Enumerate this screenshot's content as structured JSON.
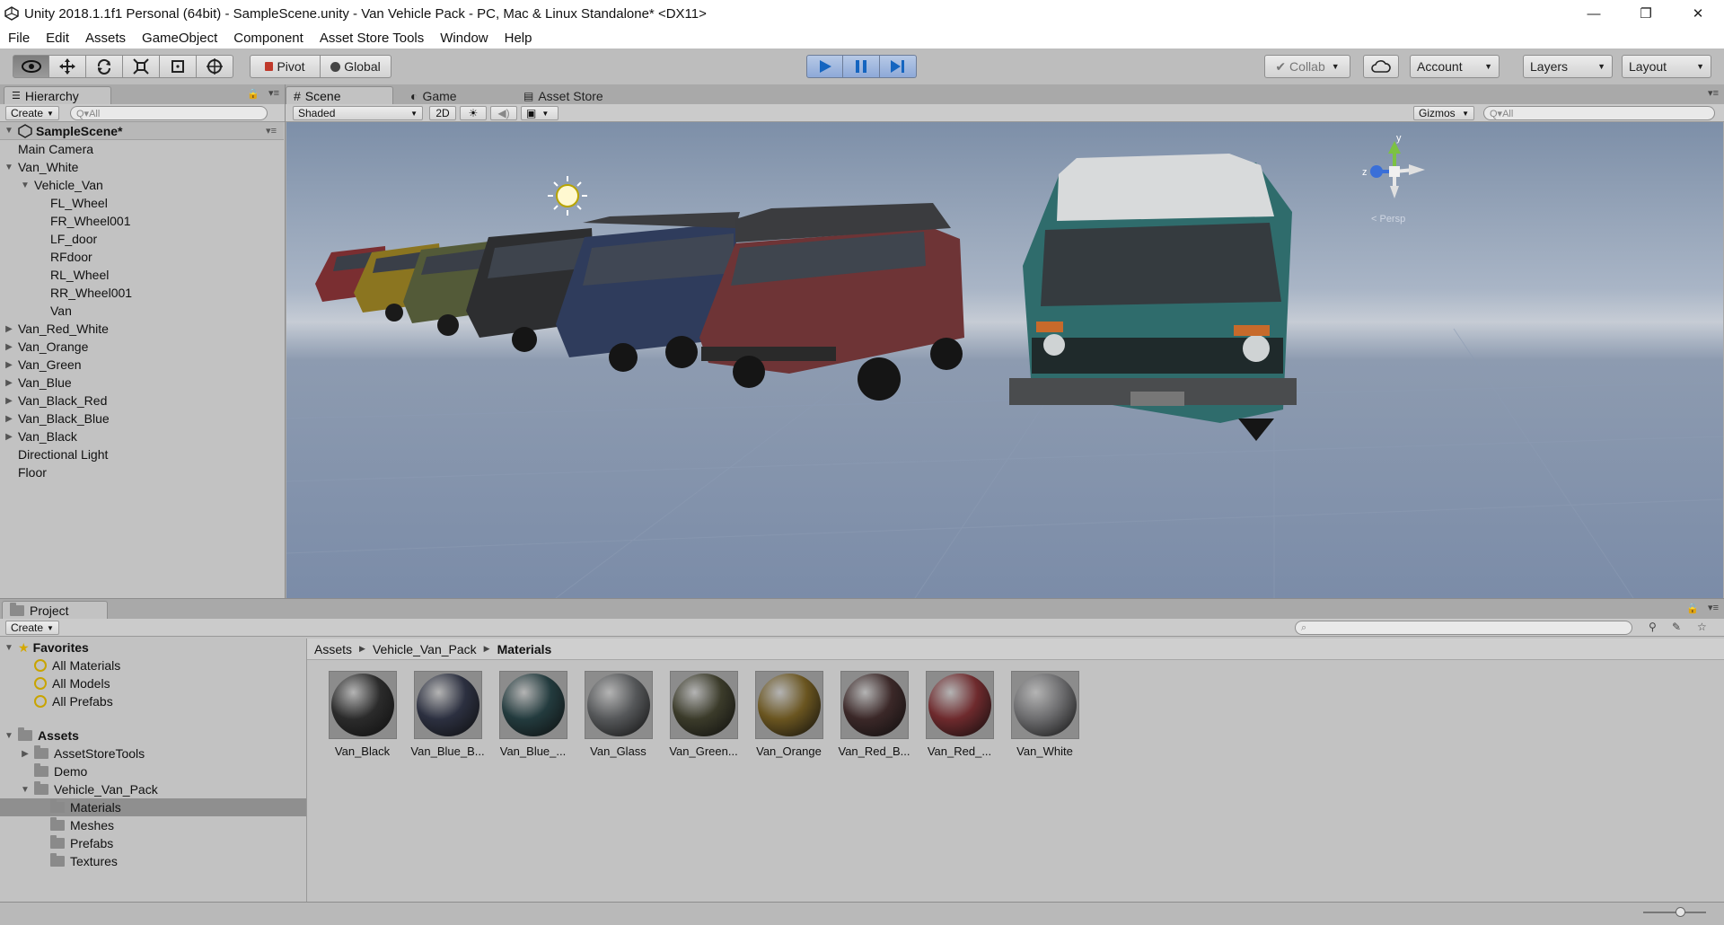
{
  "window": {
    "title": "Unity 2018.1.1f1 Personal (64bit) - SampleScene.unity - Van Vehicle Pack - PC, Mac & Linux Standalone* <DX11>",
    "minimize": "—",
    "maximize": "❐",
    "close": "✕"
  },
  "menu": [
    "File",
    "Edit",
    "Assets",
    "GameObject",
    "Component",
    "Asset Store Tools",
    "Window",
    "Help"
  ],
  "toolbar": {
    "pivot": "Pivot",
    "global": "Global",
    "collab": "Collab",
    "account": "Account",
    "layers": "Layers",
    "layout": "Layout",
    "playmode_active": true
  },
  "hierarchy": {
    "tab": "Hierarchy",
    "create": "Create",
    "search_placeholder": "Q▾All",
    "scene": "SampleScene*",
    "items": [
      {
        "label": "Main Camera",
        "depth": 1,
        "arrow": ""
      },
      {
        "label": "Van_White",
        "depth": 1,
        "arrow": "▼"
      },
      {
        "label": "Vehicle_Van",
        "depth": 2,
        "arrow": "▼"
      },
      {
        "label": "FL_Wheel",
        "depth": 3,
        "arrow": ""
      },
      {
        "label": "FR_Wheel001",
        "depth": 3,
        "arrow": ""
      },
      {
        "label": "LF_door",
        "depth": 3,
        "arrow": ""
      },
      {
        "label": "RFdoor",
        "depth": 3,
        "arrow": ""
      },
      {
        "label": "RL_Wheel",
        "depth": 3,
        "arrow": ""
      },
      {
        "label": "RR_Wheel001",
        "depth": 3,
        "arrow": ""
      },
      {
        "label": "Van",
        "depth": 3,
        "arrow": ""
      },
      {
        "label": "Van_Red_White",
        "depth": 1,
        "arrow": "▶"
      },
      {
        "label": "Van_Orange",
        "depth": 1,
        "arrow": "▶"
      },
      {
        "label": "Van_Green",
        "depth": 1,
        "arrow": "▶"
      },
      {
        "label": "Van_Blue",
        "depth": 1,
        "arrow": "▶"
      },
      {
        "label": "Van_Black_Red",
        "depth": 1,
        "arrow": "▶"
      },
      {
        "label": "Van_Black_Blue",
        "depth": 1,
        "arrow": "▶"
      },
      {
        "label": "Van_Black",
        "depth": 1,
        "arrow": "▶"
      },
      {
        "label": "Directional Light",
        "depth": 1,
        "arrow": ""
      },
      {
        "label": "Floor",
        "depth": 1,
        "arrow": ""
      }
    ]
  },
  "scene": {
    "tabs": [
      {
        "label": "Scene",
        "icon": "#",
        "active": true
      },
      {
        "label": "Game",
        "icon": "◐",
        "active": false
      },
      {
        "label": "Asset Store",
        "icon": "▤",
        "active": false
      }
    ],
    "shading": "Shaded",
    "mode_2d": "2D",
    "gizmos": "Gizmos",
    "search_placeholder": "Q▾All",
    "persp_label": "< Persp",
    "axis_y": "y",
    "axis_z": "z"
  },
  "project": {
    "tab": "Project",
    "create": "Create",
    "favorites_label": "Favorites",
    "favorites": [
      "All Materials",
      "All Models",
      "All Prefabs"
    ],
    "assets_label": "Assets",
    "folders": [
      {
        "label": "AssetStoreTools",
        "depth": 1,
        "arrow": "▶",
        "selected": false
      },
      {
        "label": "Demo",
        "depth": 1,
        "arrow": "",
        "selected": false
      },
      {
        "label": "Vehicle_Van_Pack",
        "depth": 1,
        "arrow": "▼",
        "selected": false
      },
      {
        "label": "Materials",
        "depth": 2,
        "arrow": "",
        "selected": true
      },
      {
        "label": "Meshes",
        "depth": 2,
        "arrow": "",
        "selected": false
      },
      {
        "label": "Prefabs",
        "depth": 2,
        "arrow": "",
        "selected": false
      },
      {
        "label": "Textures",
        "depth": 2,
        "arrow": "",
        "selected": false
      }
    ],
    "breadcrumb": [
      "Assets",
      "Vehicle_Van_Pack",
      "Materials"
    ],
    "materials": [
      {
        "label": "Van_Black",
        "color": "#2b2b2b"
      },
      {
        "label": "Van_Blue_B...",
        "color": "#2c3040"
      },
      {
        "label": "Van_Blue_...",
        "color": "#233b3e"
      },
      {
        "label": "Van_Glass",
        "color": "#555759"
      },
      {
        "label": "Van_Green...",
        "color": "#3b3b2a"
      },
      {
        "label": "Van_Orange",
        "color": "#6a5520"
      },
      {
        "label": "Van_Red_B...",
        "color": "#3b2828"
      },
      {
        "label": "Van_Red_...",
        "color": "#6e2a2d"
      },
      {
        "label": "Van_White",
        "color": "#6c6c6e"
      }
    ]
  },
  "colors": {
    "play_active": "#8ea9d8",
    "selection": "#8f8f8f",
    "sky_top": "#7c8fa8",
    "ground": "#7e8fa8"
  }
}
